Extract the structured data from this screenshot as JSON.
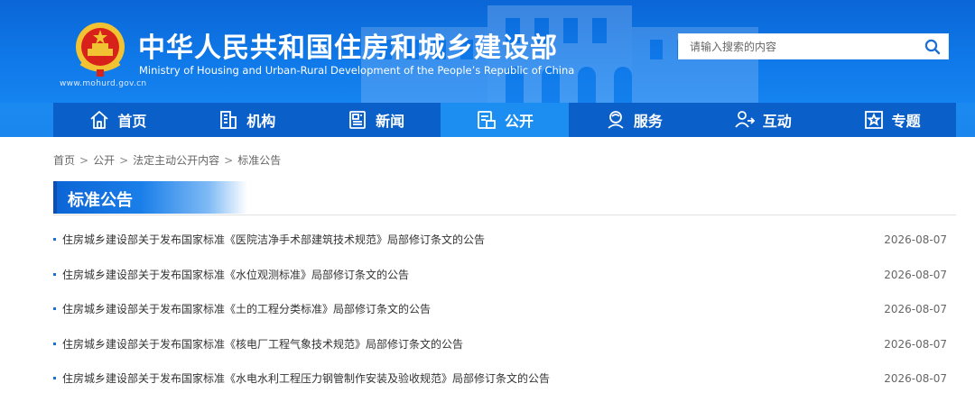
{
  "header": {
    "title_cn": "中华人民共和国住房和城乡建设部",
    "title_en": "Ministry of Housing and Urban-Rural Development of the People’s Republic of China",
    "url": "www.mohurd.gov.cn",
    "search_placeholder": "请输入搜索的内容"
  },
  "nav": [
    {
      "label": "首页",
      "icon": "home-icon"
    },
    {
      "label": "机构",
      "icon": "building-icon"
    },
    {
      "label": "新闻",
      "icon": "newspaper-icon"
    },
    {
      "label": "公开",
      "icon": "document-icon",
      "active": true
    },
    {
      "label": "服务",
      "icon": "service-icon"
    },
    {
      "label": "互动",
      "icon": "interaction-icon"
    },
    {
      "label": "专题",
      "icon": "star-icon"
    }
  ],
  "breadcrumb": [
    "首页",
    "公开",
    "法定主动公开内容",
    "标准公告"
  ],
  "section_title": "标准公告",
  "list": [
    {
      "title": "住房城乡建设部关于发布国家标准《医院洁净手术部建筑技术规范》局部修订条文的公告",
      "date": "2026-08-07"
    },
    {
      "title": "住房城乡建设部关于发布国家标准《水位观测标准》局部修订条文的公告",
      "date": "2026-08-07"
    },
    {
      "title": "住房城乡建设部关于发布国家标准《土的工程分类标准》局部修订条文的公告",
      "date": "2026-08-07"
    },
    {
      "title": "住房城乡建设部关于发布国家标准《核电厂工程气象技术规范》局部修订条文的公告",
      "date": "2026-08-07"
    },
    {
      "title": "住房城乡建设部关于发布国家标准《水电水利工程压力钢管制作安装及验收规范》局部修订条文的公告",
      "date": "2026-08-07"
    }
  ],
  "colors": {
    "header_blue": "#0f78e8",
    "nav_dark": "#0a5fc9",
    "nav_active": "#1c8ef2",
    "accent": "#1a6fd6"
  }
}
